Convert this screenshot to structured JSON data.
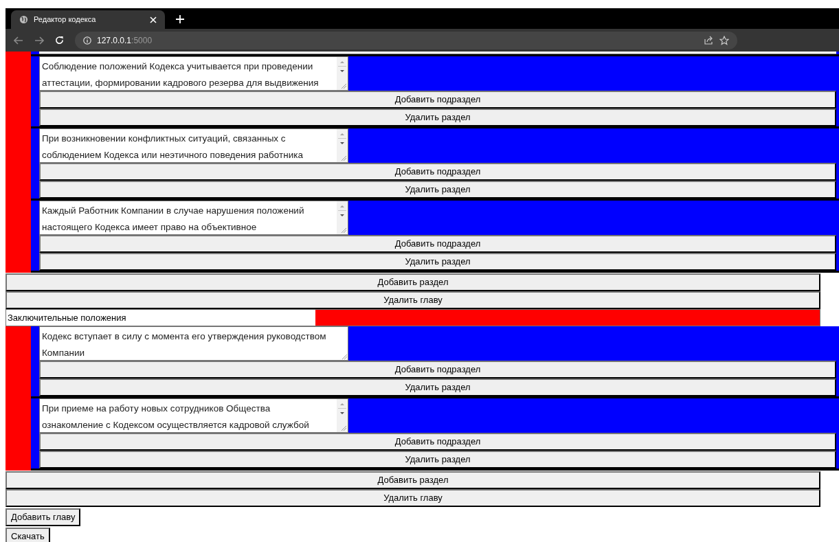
{
  "browser": {
    "tab_title": "Редактор кодекса",
    "url_host": "127.0.0.1",
    "url_port": ":5000"
  },
  "chapters": [
    {
      "sections": [
        {
          "text": "Соблюдение положений Кодекса учитывается при проведении аттестации, формировании кадрового резерва для выдвижения",
          "scrollbar": true,
          "add_label": "Добавить подраздел",
          "delete_label": "Удалить раздел"
        },
        {
          "text": "При возникновении конфликтных ситуаций, связанных с соблюдением Кодекса или неэтичного поведения работника",
          "scrollbar": true,
          "add_label": "Добавить подраздел",
          "delete_label": "Удалить раздел"
        },
        {
          "text": "Каждый Работник Компании в случае нарушения положений настоящего Кодекса имеет право на объективное",
          "scrollbar": true,
          "add_label": "Добавить подраздел",
          "delete_label": "Удалить раздел"
        }
      ],
      "add_section_label": "Добавить раздел",
      "delete_chapter_label": "Удалить главу"
    },
    {
      "title": "Заключительные положения",
      "sections": [
        {
          "text": "Кодекс вступает в силу с момента его утверждения руководством Компании",
          "scrollbar": false,
          "add_label": "Добавить подраздел",
          "delete_label": "Удалить раздел"
        },
        {
          "text": "При приеме на работу новых сотрудников Общества ознакомление с Кодексом осуществляется кадровой службой",
          "scrollbar": true,
          "add_label": "Добавить подраздел",
          "delete_label": "Удалить раздел"
        }
      ],
      "add_section_label": "Добавить раздел",
      "delete_chapter_label": "Удалить главу"
    }
  ],
  "add_chapter_label": "Добавить главу",
  "download_label": "Скачать"
}
